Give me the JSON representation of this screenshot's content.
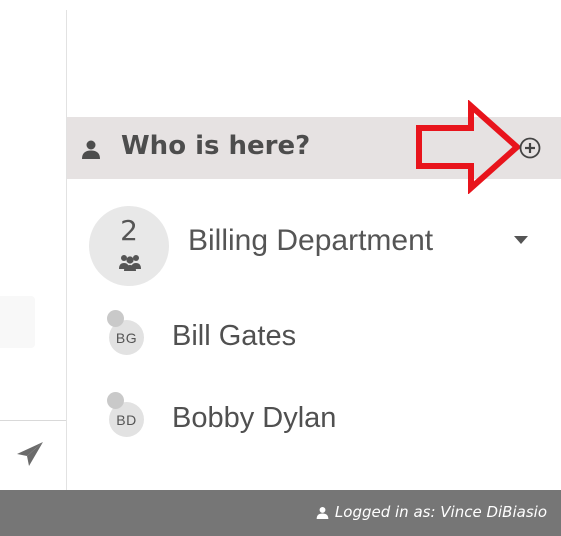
{
  "who_panel": {
    "title": "Who is here?",
    "icons": {
      "header": "user-icon",
      "add": "plus-circle-icon",
      "annotation": "red-arrow-icon"
    }
  },
  "group": {
    "count": "2",
    "name": "Billing Department",
    "icons": {
      "people": "users-icon",
      "toggle": "caret-down-icon"
    }
  },
  "users": [
    {
      "initials": "BG",
      "name": "Bill Gates"
    },
    {
      "initials": "BD",
      "name": "Bobby Dylan"
    }
  ],
  "composer": {
    "send_icon": "paper-plane-icon"
  },
  "footer": {
    "logged_in_text": "Logged in as: Vince DiBiasio"
  },
  "colors": {
    "header_bg": "#e6e2e2",
    "footer_bg": "#767676",
    "annotation_red": "#e8141c"
  }
}
